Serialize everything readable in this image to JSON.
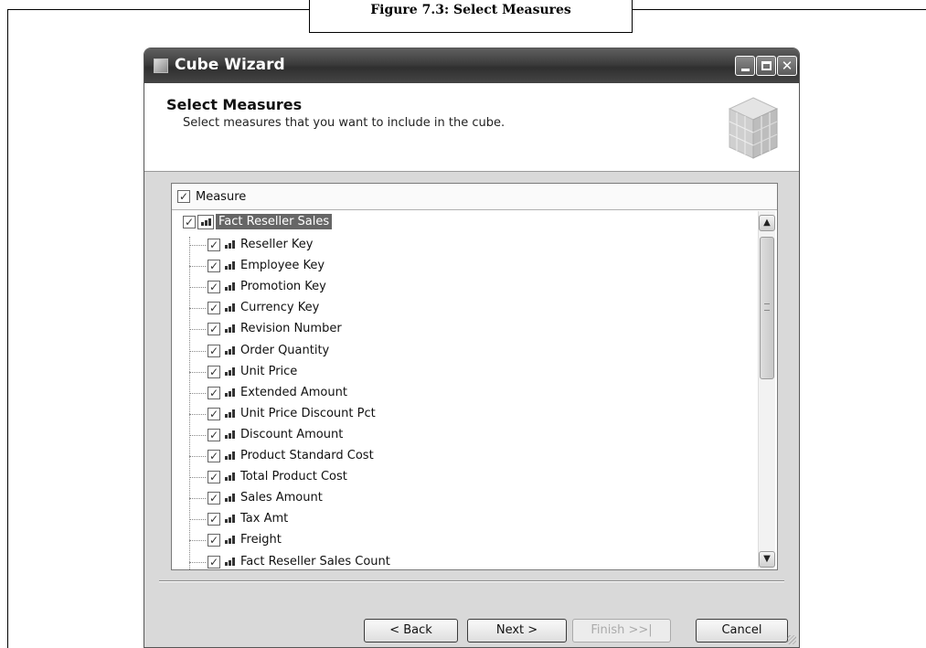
{
  "figure": {
    "caption": "Figure 7.3: Select Measures"
  },
  "window": {
    "title": "Cube Wizard",
    "controls": {
      "minimize": "minimize",
      "maximize": "maximize",
      "close": "✕"
    }
  },
  "header": {
    "title": "Select Measures",
    "subtitle": "Select measures that you want to include in the cube."
  },
  "tree": {
    "column_header": "Measure",
    "root": {
      "label": "Fact Reseller Sales",
      "checked": true
    },
    "items": [
      {
        "label": "Reseller Key",
        "checked": true
      },
      {
        "label": "Employee Key",
        "checked": true
      },
      {
        "label": "Promotion Key",
        "checked": true
      },
      {
        "label": "Currency Key",
        "checked": true
      },
      {
        "label": "Revision Number",
        "checked": true
      },
      {
        "label": "Order Quantity",
        "checked": true
      },
      {
        "label": "Unit Price",
        "checked": true
      },
      {
        "label": "Extended Amount",
        "checked": true
      },
      {
        "label": "Unit Price Discount Pct",
        "checked": true
      },
      {
        "label": "Discount Amount",
        "checked": true
      },
      {
        "label": "Product Standard Cost",
        "checked": true
      },
      {
        "label": "Total Product Cost",
        "checked": true
      },
      {
        "label": "Sales Amount",
        "checked": true
      },
      {
        "label": "Tax Amt",
        "checked": true
      },
      {
        "label": "Freight",
        "checked": true
      },
      {
        "label": "Fact Reseller Sales Count",
        "checked": true
      }
    ]
  },
  "buttons": {
    "back": "< Back",
    "next": "Next >",
    "finish": "Finish >>|",
    "cancel": "Cancel"
  },
  "icons": {
    "check": "✓",
    "scroll_up": "▲",
    "scroll_down": "▼"
  }
}
